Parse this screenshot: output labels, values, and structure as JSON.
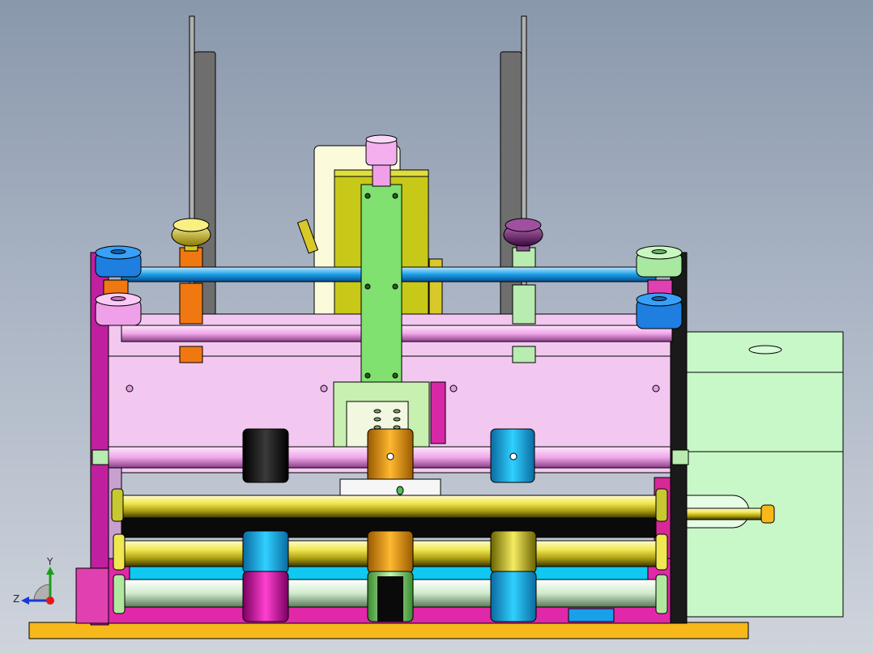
{
  "window": {
    "title": ""
  },
  "triad": {
    "x_label": "",
    "y_label": "Y",
    "z_label": "Z"
  },
  "colors": {
    "background_top": "#8a98ac",
    "background_bottom": "#cfd4dc",
    "frame_magenta": "#d81ea8",
    "plate_pink": "#f2c8f0",
    "roller_yellow": "#e8e04a",
    "roller_blue": "#1e7fe0",
    "roller_cyan": "#19c2e8",
    "roller_orange": "#f39a10",
    "roller_green": "#b8ecb0",
    "base_orange": "#f6b81a",
    "motor_green": "#c8f7c8",
    "knob_yellow": "#f0e040",
    "knob_purple": "#6a1a6a",
    "guide_grey": "#6e6e6e",
    "screw_pink": "#f0a0e8"
  },
  "icons": [
    "axis-triad-icon"
  ]
}
